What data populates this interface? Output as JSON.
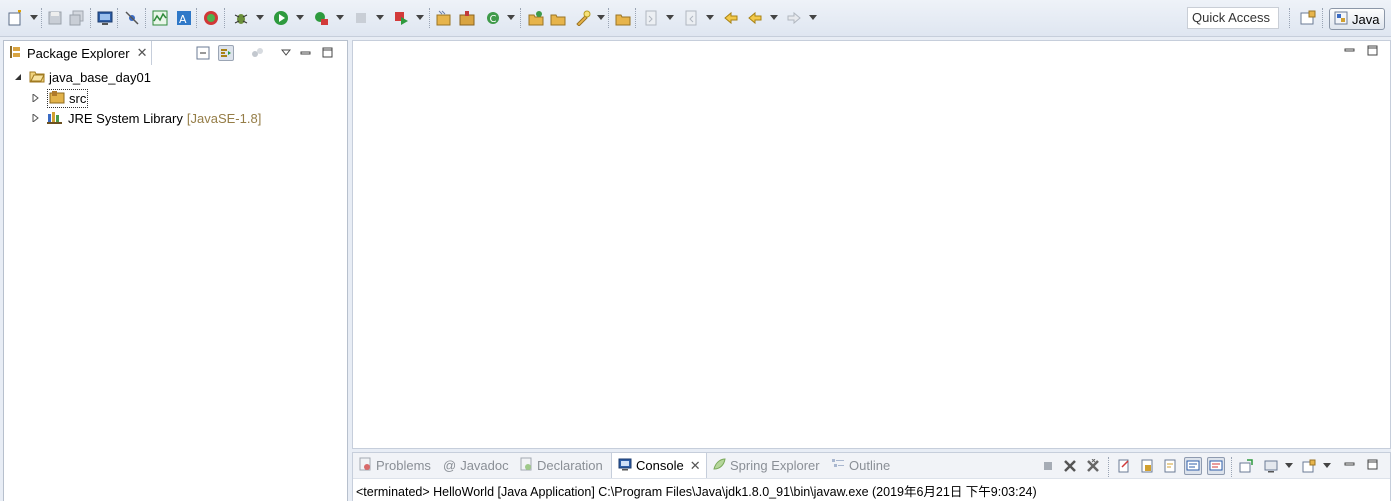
{
  "toolbar": {
    "quick_access_placeholder": "Quick Access",
    "perspective_label": "Java"
  },
  "package_explorer": {
    "tab_title": "Package Explorer",
    "tree": {
      "project_name": "java_base_day01",
      "children": [
        {
          "label": "src",
          "decoration": ""
        },
        {
          "label": "JRE System Library",
          "decoration": "[JavaSE-1.8]"
        }
      ]
    }
  },
  "bottom_panel": {
    "tabs": [
      {
        "label": "Problems",
        "icon": "problems-icon"
      },
      {
        "label": "Javadoc",
        "icon": "javadoc-icon"
      },
      {
        "label": "Declaration",
        "icon": "declaration-icon"
      },
      {
        "label": "Console",
        "icon": "console-icon",
        "active": true
      },
      {
        "label": "Spring Explorer",
        "icon": "spring-icon"
      },
      {
        "label": "Outline",
        "icon": "outline-icon"
      }
    ],
    "console_output": "<terminated> HelloWorld [Java Application] C:\\Program Files\\Java\\jdk1.8.0_91\\bin\\javaw.exe (2019年6月21日 下午9:03:24)"
  },
  "colors": {
    "toolbar_bg": "#dfe6f1",
    "library_decoration": "#957d47",
    "inactive_tab_text": "#8a8f96"
  }
}
